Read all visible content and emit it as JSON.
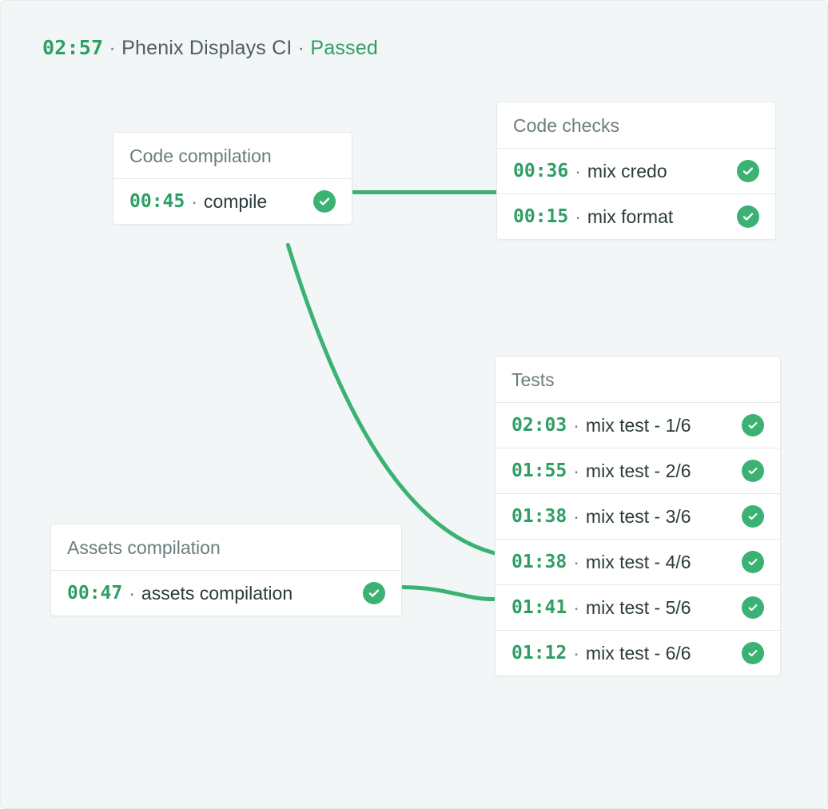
{
  "colors": {
    "accent": "#3bb273",
    "green_text": "#2f9e63",
    "muted": "#6b7d7d"
  },
  "header": {
    "duration": "02:57",
    "name": "Phenix Displays CI",
    "status": "Passed"
  },
  "separator": "·",
  "stages": {
    "compile": {
      "title": "Code compilation",
      "jobs": [
        {
          "duration": "00:45",
          "label": "compile",
          "status": "passed"
        }
      ]
    },
    "checks": {
      "title": "Code checks",
      "jobs": [
        {
          "duration": "00:36",
          "label": "mix credo",
          "status": "passed"
        },
        {
          "duration": "00:15",
          "label": "mix format",
          "status": "passed"
        }
      ]
    },
    "assets": {
      "title": "Assets compilation",
      "jobs": [
        {
          "duration": "00:47",
          "label": "assets compilation",
          "status": "passed"
        }
      ]
    },
    "tests": {
      "title": "Tests",
      "jobs": [
        {
          "duration": "02:03",
          "label": "mix test - 1/6",
          "status": "passed"
        },
        {
          "duration": "01:55",
          "label": "mix test - 2/6",
          "status": "passed"
        },
        {
          "duration": "01:38",
          "label": "mix test - 3/6",
          "status": "passed"
        },
        {
          "duration": "01:38",
          "label": "mix test - 4/6",
          "status": "passed"
        },
        {
          "duration": "01:41",
          "label": "mix test - 5/6",
          "status": "passed"
        },
        {
          "duration": "01:12",
          "label": "mix test - 6/6",
          "status": "passed"
        }
      ]
    }
  }
}
